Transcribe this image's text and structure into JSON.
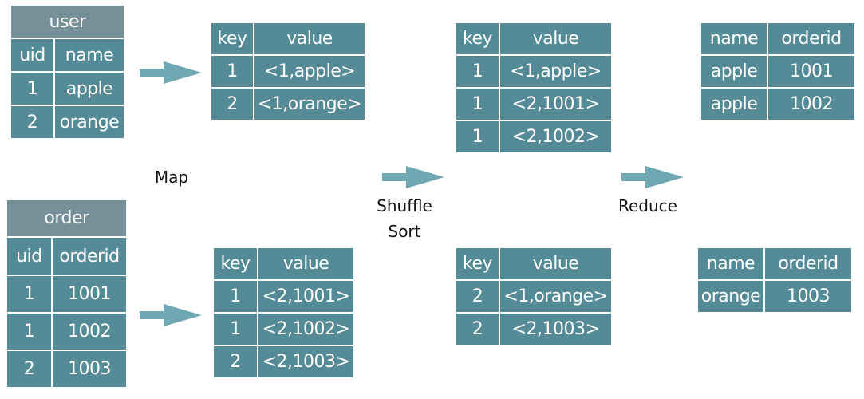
{
  "colors": {
    "cell": "#558b96",
    "title_cell": "#76909a",
    "arrow": "#6fa7b2",
    "text": "#ffffff",
    "label": "#111111"
  },
  "tables": {
    "user": {
      "title": "user",
      "headers": [
        "uid",
        "name"
      ],
      "rows": [
        [
          "1",
          "apple"
        ],
        [
          "2",
          "orange"
        ]
      ]
    },
    "order": {
      "title": "order",
      "headers": [
        "uid",
        "orderid"
      ],
      "rows": [
        [
          "1",
          "1001"
        ],
        [
          "1",
          "1002"
        ],
        [
          "2",
          "1003"
        ]
      ]
    },
    "map_user": {
      "headers": [
        "key",
        "value"
      ],
      "rows": [
        [
          "1",
          "<1,apple>"
        ],
        [
          "2",
          "<1,orange>"
        ]
      ]
    },
    "map_order": {
      "headers": [
        "key",
        "value"
      ],
      "rows": [
        [
          "1",
          "<2,1001>"
        ],
        [
          "1",
          "<2,1002>"
        ],
        [
          "2",
          "<2,1003>"
        ]
      ]
    },
    "shuffle_key1": {
      "headers": [
        "key",
        "value"
      ],
      "rows": [
        [
          "1",
          "<1,apple>"
        ],
        [
          "1",
          "<2,1001>"
        ],
        [
          "1",
          "<2,1002>"
        ]
      ]
    },
    "shuffle_key2": {
      "headers": [
        "key",
        "value"
      ],
      "rows": [
        [
          "2",
          "<1,orange>"
        ],
        [
          "2",
          "<2,1003>"
        ]
      ]
    },
    "reduce_apple": {
      "headers": [
        "name",
        "orderid"
      ],
      "rows": [
        [
          "apple",
          "1001"
        ],
        [
          "apple",
          "1002"
        ]
      ]
    },
    "reduce_orange": {
      "headers": [
        "name",
        "orderid"
      ],
      "rows": [
        [
          "orange",
          "1003"
        ]
      ]
    }
  },
  "stages": {
    "map": "Map",
    "shuffle": "Shuffle",
    "sort": "Sort",
    "reduce": "Reduce"
  }
}
